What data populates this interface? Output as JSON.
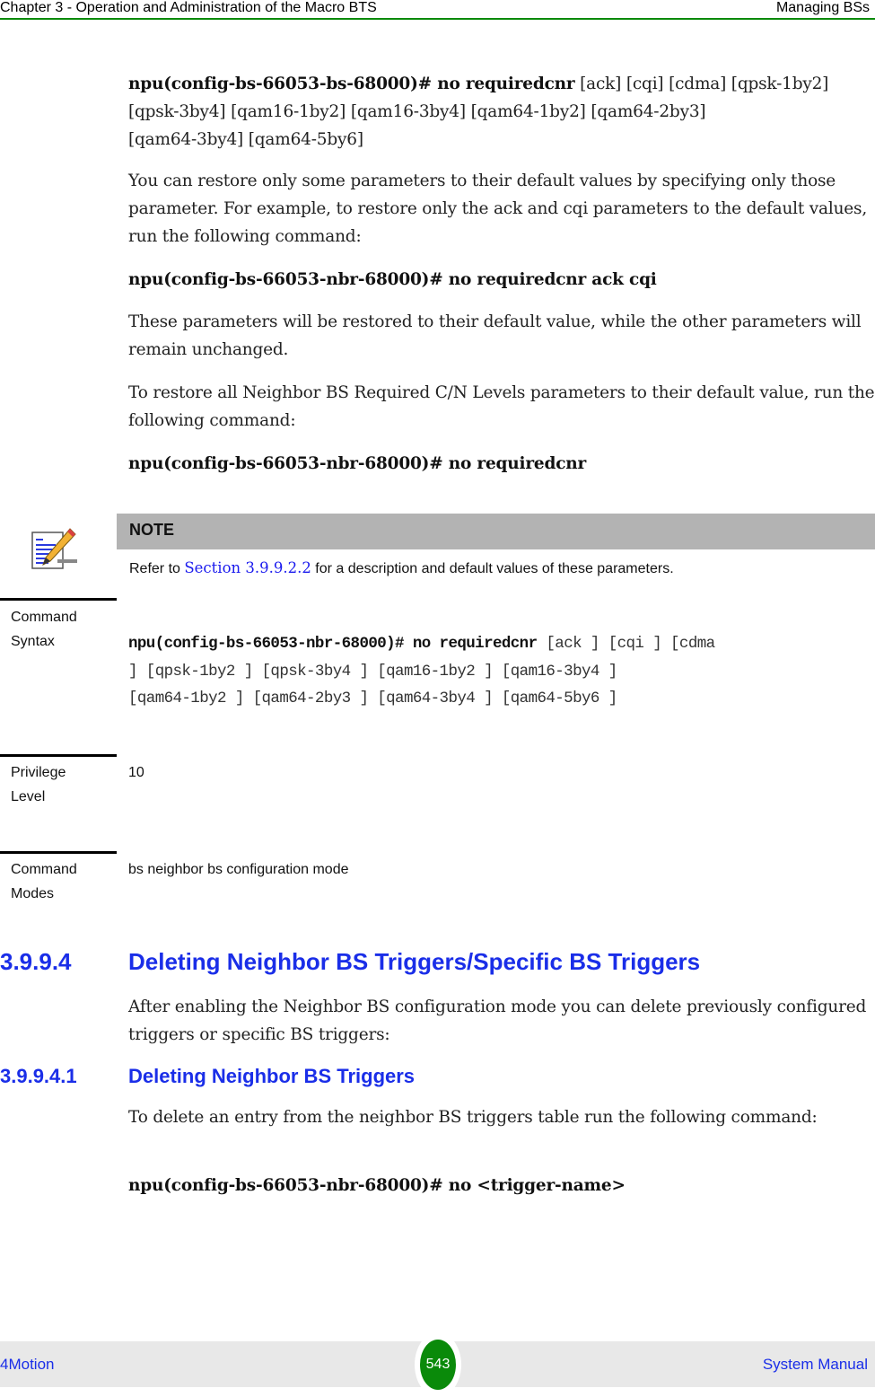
{
  "header": {
    "chapter": "Chapter 3 - Operation and Administration of the Macro BTS",
    "section": "Managing BSs"
  },
  "body": {
    "cmd1": {
      "bold": "npu(config-bs-66053-bs-68000)# no requiredcnr",
      "args_line1": " [ack] [cqi] [cdma] [qpsk-1by2]",
      "args_line2": "[qpsk-3by4] [qam16-1by2] [qam16-3by4] [qam64-1by2] [qam64-2by3]",
      "args_line3": "[qam64-3by4] [qam64-5by6]"
    },
    "para1": "You can restore only some parameters to their default values by specifying only those parameter. For example, to restore only the ack and cqi parameters to the default values, run the following command:",
    "cmd2": "npu(config-bs-66053-nbr-68000)# no requiredcnr ack cqi",
    "para2": "These parameters will be restored to their default value, while the other parameters will remain unchanged.",
    "para3": "To restore all Neighbor BS Required C/N Levels parameters to their default value, run the following command:",
    "cmd3": "npu(config-bs-66053-nbr-68000)# no requiredcnr"
  },
  "note": {
    "icon": "note-pencil-icon",
    "title": "NOTE",
    "text_before": "Refer to ",
    "link": "Section 3.9.9.2.2",
    "text_after": " for a description and default values of these parameters."
  },
  "command_syntax": {
    "label_line1": "Command",
    "label_line2": "Syntax",
    "bold": "npu(config-bs-66053-nbr-68000)# no requiredcnr",
    "args_line1": " [ack ] [cqi ] [cdma",
    "args_line2": "] [qpsk-1by2 ] [qpsk-3by4 ] [qam16-1by2 ] [qam16-3by4 ]",
    "args_line3": "[qam64-1by2 ] [qam64-2by3 ] [qam64-3by4 ] [qam64-5by6 ]"
  },
  "privilege_level": {
    "label_line1": "Privilege",
    "label_line2": "Level",
    "value": "10"
  },
  "command_modes": {
    "label_line1": "Command",
    "label_line2": "Modes",
    "value": "bs neighbor bs configuration mode"
  },
  "section_3994": {
    "number": "3.9.9.4",
    "title": "Deleting Neighbor BS Triggers/Specific BS Triggers",
    "text": "After enabling the Neighbor BS configuration mode you can delete previously configured triggers or specific BS triggers:"
  },
  "section_39941": {
    "number": "3.9.9.4.1",
    "title": "Deleting Neighbor BS Triggers",
    "text": "To delete an entry from the neighbor BS triggers table run the following command:",
    "cmd": "npu(config-bs-66053-nbr-68000)# no <trigger-name>"
  },
  "footer": {
    "product": "4Motion",
    "page": "543",
    "manual": "System Manual"
  },
  "colors": {
    "accent_green": "#0a8a0a",
    "heading_blue": "#1a2ee8",
    "link_blue": "#1a1aee",
    "note_bar": "#b3b3b3",
    "footer_bg": "#e8e8e8"
  }
}
